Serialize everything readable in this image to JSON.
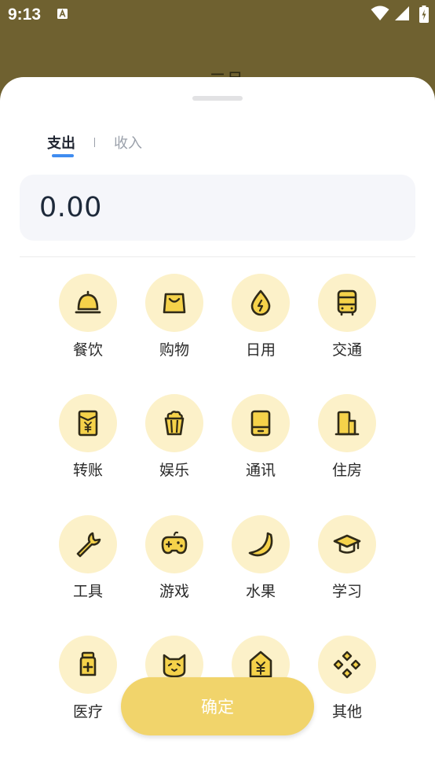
{
  "status_bar": {
    "time": "9:13"
  },
  "background": {
    "title": "一二月"
  },
  "tabs": {
    "expense": "支出",
    "income": "收入"
  },
  "amount": {
    "value": "0.00"
  },
  "categories": [
    {
      "label": "餐饮",
      "icon": "bell-icon"
    },
    {
      "label": "购物",
      "icon": "shopping-bag-icon"
    },
    {
      "label": "日用",
      "icon": "drop-icon"
    },
    {
      "label": "交通",
      "icon": "bus-icon"
    },
    {
      "label": "转账",
      "icon": "yuan-envelope-icon"
    },
    {
      "label": "娱乐",
      "icon": "popcorn-icon"
    },
    {
      "label": "通讯",
      "icon": "phone-icon"
    },
    {
      "label": "住房",
      "icon": "building-icon"
    },
    {
      "label": "工具",
      "icon": "wrench-icon"
    },
    {
      "label": "游戏",
      "icon": "gamepad-icon"
    },
    {
      "label": "水果",
      "icon": "banana-icon"
    },
    {
      "label": "学习",
      "icon": "graduation-cap-icon"
    },
    {
      "label": "医疗",
      "icon": "medicine-bottle-icon"
    },
    {
      "label": "",
      "icon": "cat-icon"
    },
    {
      "label": "",
      "icon": "yuan-house-icon"
    },
    {
      "label": "其他",
      "icon": "diamond-grid-icon"
    }
  ],
  "confirm_button": {
    "label": "确定"
  },
  "colors": {
    "backdrop": "#6f6130",
    "accent_blue": "#3f8cf0",
    "icon_circle": "#fcf1c9",
    "icon_yellow": "#f5d24a",
    "icon_stroke": "#2f2a18",
    "confirm_yellow": "#f1d46b"
  }
}
